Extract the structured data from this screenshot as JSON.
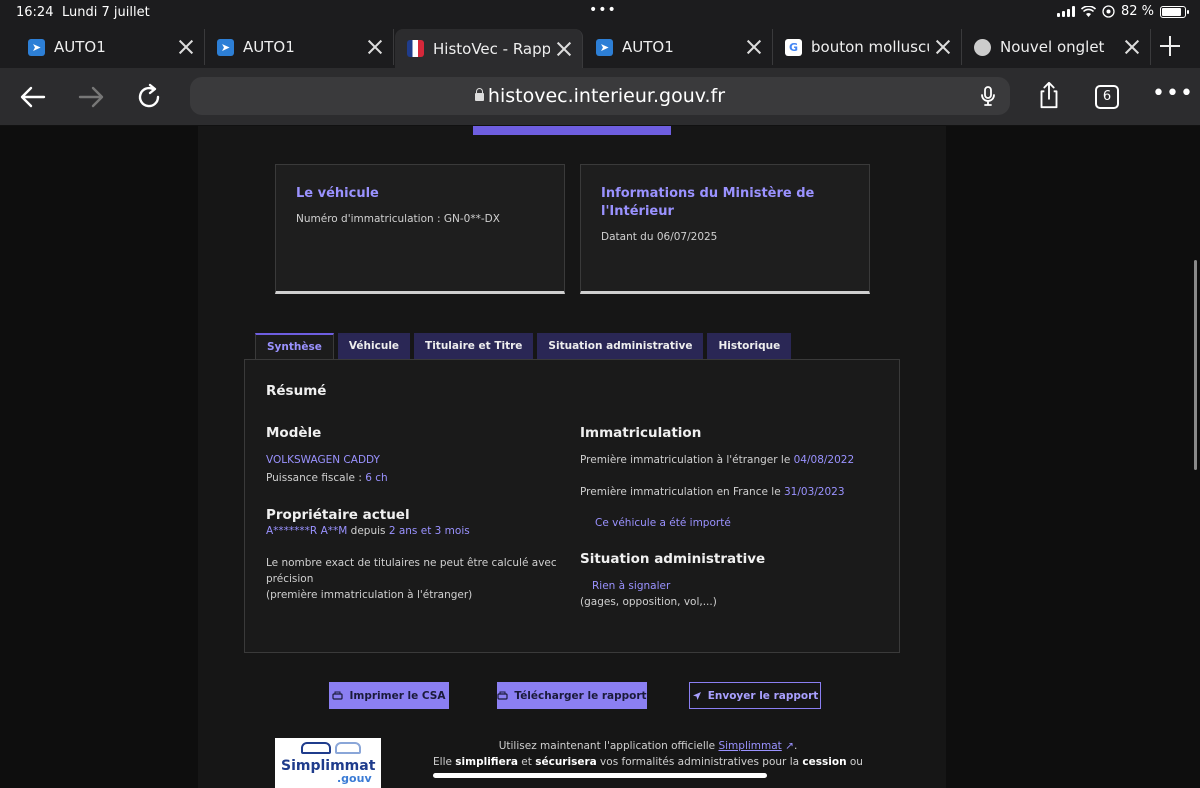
{
  "status": {
    "time": "16:24",
    "date": "Lundi 7 juillet",
    "battery": "82 %"
  },
  "tabs": [
    {
      "title": "AUTO1",
      "favicon": "auto1-icon",
      "active": false
    },
    {
      "title": "AUTO1",
      "favicon": "auto1-icon",
      "active": false
    },
    {
      "title": "HistoVec - Rapp",
      "favicon": "gouv-flag-icon",
      "active": true
    },
    {
      "title": "AUTO1",
      "favicon": "auto1-icon",
      "active": false
    },
    {
      "title": "bouton molluscu",
      "favicon": "google-icon",
      "active": false
    },
    {
      "title": "Nouvel onglet",
      "favicon": "globe-icon",
      "active": false
    }
  ],
  "toolbar": {
    "url": "histovec.interieur.gouv.fr",
    "tab_count": "6"
  },
  "cards": {
    "vehicle": {
      "title": "Le véhicule",
      "text": "Numéro d'immatriculation : GN-0**-DX"
    },
    "ministry": {
      "title": "Informations du Ministère de l'Intérieur",
      "text": "Datant du 06/07/2025"
    }
  },
  "report_tabs": [
    "Synthèse",
    "Véhicule",
    "Titulaire et Titre",
    "Situation administrative",
    "Historique"
  ],
  "summary": {
    "heading": "Résumé",
    "model": {
      "heading": "Modèle",
      "name": "VOLKSWAGEN CADDY",
      "power_label": "Puissance fiscale : ",
      "power_value": "6 ch"
    },
    "owner": {
      "heading": "Propriétaire actuel",
      "name": "A*******R A**M",
      "since_label": " depuis ",
      "since_value": "2 ans et 3 mois",
      "note1": "Le nombre exact de titulaires ne peut être calculé avec précision",
      "note2": "(première immatriculation à l'étranger)"
    },
    "registration": {
      "heading": "Immatriculation",
      "foreign_label": "Première immatriculation à l'étranger le ",
      "foreign_date": "04/08/2022",
      "france_label": "Première immatriculation en France le ",
      "france_date": "31/03/2023",
      "imported": "Ce véhicule a été importé"
    },
    "admin": {
      "heading": "Situation administrative",
      "status": "Rien à signaler",
      "detail": "(gages, opposition, vol,...)"
    }
  },
  "actions": {
    "print": "Imprimer le CSA",
    "download": "Télécharger le rapport",
    "send": "Envoyer le rapport"
  },
  "footer": {
    "logo_name": "Simplimmat",
    "logo_suffix": ".gouv",
    "line1_prefix": "Utilisez maintenant l'application officielle ",
    "line1_link": "Simplimmat",
    "line2_a": "Elle ",
    "line2_b": "simplifiera",
    "line2_c": " et ",
    "line2_d": "sécurisera",
    "line2_e": " vos formalités administratives pour la ",
    "line2_f": "cession",
    "line2_g": " ou"
  },
  "colors": {
    "accent": "#8b7ff2",
    "link": "#9a92ff",
    "tab_bg": "#2a2755"
  }
}
